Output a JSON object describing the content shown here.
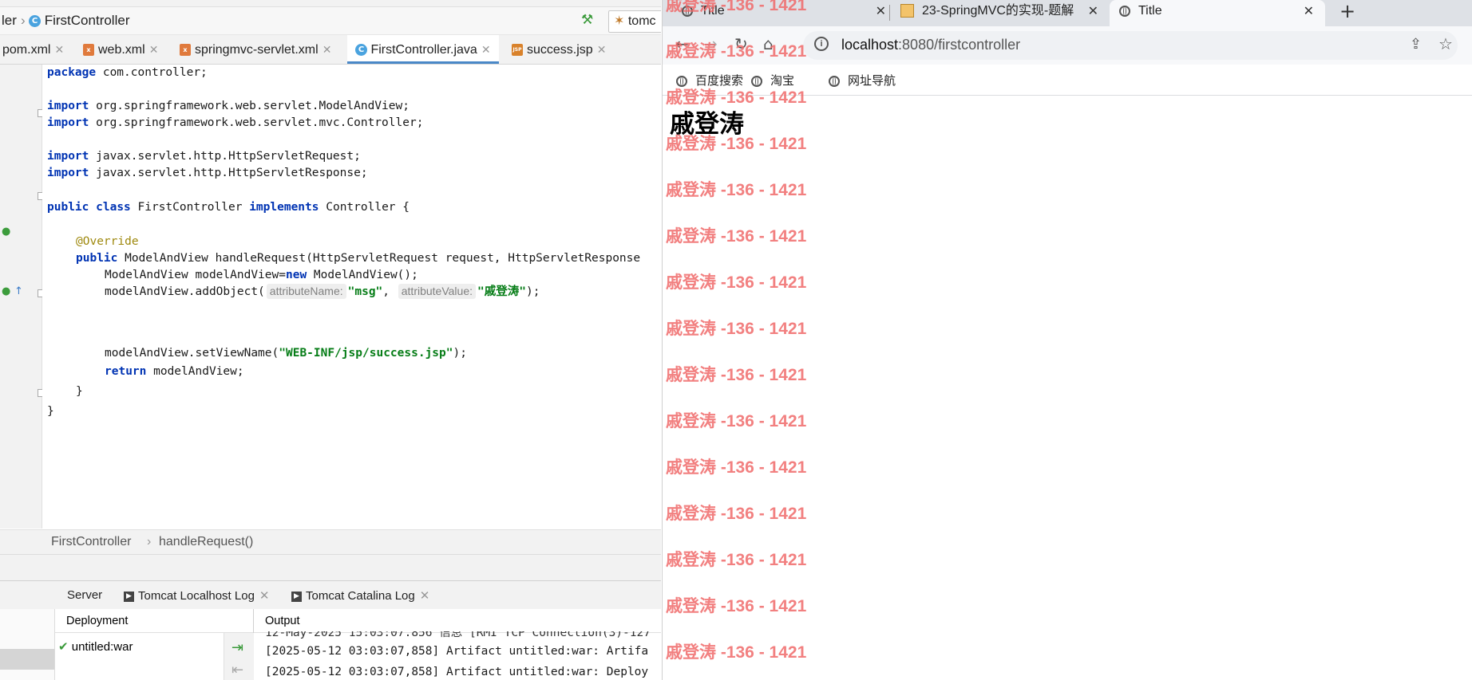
{
  "ide": {
    "breadcrumb": {
      "prev": "ler",
      "current": "FirstController"
    },
    "run_config": "tomc",
    "tabs": [
      {
        "label": "pom.xml"
      },
      {
        "label": "web.xml"
      },
      {
        "label": "springmvc-servlet.xml"
      },
      {
        "label": "FirstController.java"
      },
      {
        "label": "success.jsp"
      }
    ],
    "code": {
      "l1_kw": "package",
      "l1_rest": " com.controller;",
      "l3_kw": "import",
      "l3_rest": " org.springframework.web.servlet.ModelAndView;",
      "l4_kw": "import",
      "l4_rest": " org.springframework.web.servlet.mvc.Controller;",
      "l6_kw": "import",
      "l6_rest": " javax.servlet.http.HttpServletRequest;",
      "l7_kw": "import",
      "l7_rest": " javax.servlet.http.HttpServletResponse;",
      "l9_kw1": "public",
      "l9_kw2": "class",
      "l9_name": " FirstController ",
      "l9_kw3": "implements",
      "l9_rest": " Controller {",
      "l11_ann": "@Override",
      "l12_kw": "public",
      "l12_rest": " ModelAndView handleRequest(HttpServletRequest request, HttpServletResponse",
      "l13_a": "ModelAndView modelAndView=",
      "l13_kw": "new",
      "l13_b": " ModelAndView();",
      "l14_a": "modelAndView.addObject(",
      "l14_hint1": "attributeName:",
      "l14_str1": "\"msg\"",
      "l14_comma": ", ",
      "l14_hint2": "attributeValue:",
      "l14_str2": "\"戚登涛\"",
      "l14_end": ");",
      "l15_a": "modelAndView.setViewName(",
      "l15_str": "\"WEB-INF/jsp/success.jsp\"",
      "l15_end": ");",
      "l16_kw": "return",
      "l16_rest": " modelAndView;",
      "l17": "}",
      "l18": "}"
    },
    "status_breadcrumb": {
      "class": "FirstController",
      "method": "handleRequest()"
    },
    "services": {
      "tabs": [
        {
          "label": "Server"
        },
        {
          "label": "Tomcat Localhost Log"
        },
        {
          "label": "Tomcat Catalina Log"
        }
      ],
      "deployment_header": "Deployment",
      "deployment_item": "untitled:war",
      "output_header": "Output",
      "output_lines": [
        "12-May-2025 15:03:07.856 信息 [RMI TCP Connection(3)-127",
        "[2025-05-12 03:03:07,858] Artifact untitled:war: Artifa",
        "[2025-05-12 03:03:07,858] Artifact untitled:war: Deploy"
      ]
    }
  },
  "browser": {
    "tabs": [
      {
        "label": "Title"
      },
      {
        "label": "23-SpringMVC的实现-题解"
      },
      {
        "label": "Title"
      }
    ],
    "url_host": "localhost",
    "url_path": ":8080/firstcontroller",
    "bookmarks": [
      {
        "label": "百度搜索"
      },
      {
        "label": "淘宝"
      },
      {
        "label": "网址导航"
      }
    ],
    "page_heading": "戚登涛"
  },
  "watermark": "戚登涛 -136 - 1421",
  "colors": {
    "accent": "#4a88c7",
    "keyword": "#0033b3",
    "string": "#067d17",
    "annotation": "#9e880d",
    "watermark": "#f06a6a"
  }
}
